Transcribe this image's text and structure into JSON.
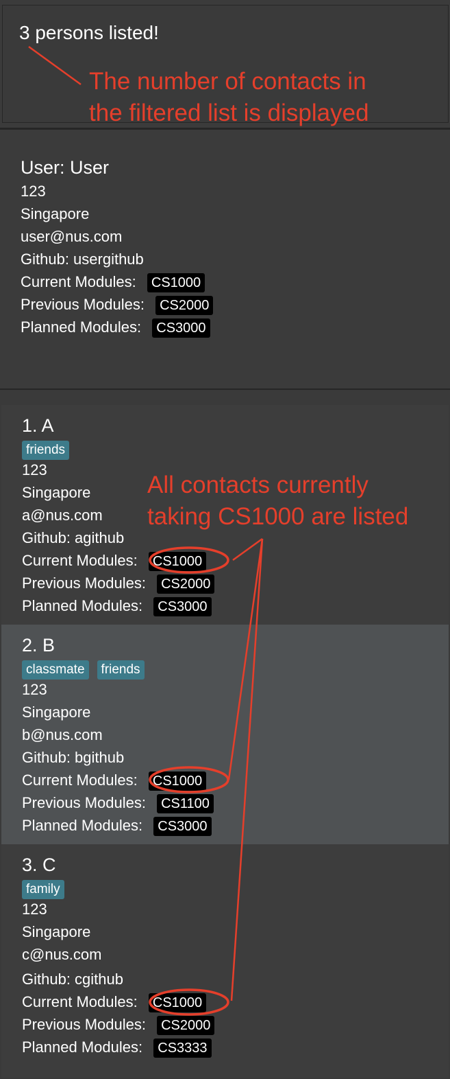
{
  "result": {
    "message": "3 persons listed!"
  },
  "user": {
    "name_line": "User:  User",
    "phone": "123",
    "address": "Singapore",
    "email": "user@nus.com",
    "github": "Github: usergithub",
    "current_label": "Current Modules:",
    "current_modules": [
      "CS1000"
    ],
    "previous_label": "Previous Modules:",
    "previous_modules": [
      "CS2000"
    ],
    "planned_label": "Planned Modules:",
    "planned_modules": [
      "CS3000"
    ]
  },
  "persons": [
    {
      "name_line": "1.  A",
      "tags": [
        "friends"
      ],
      "phone": "123",
      "address": "Singapore",
      "email": "a@nus.com",
      "github": "Github: agithub",
      "current_label": "Current Modules:",
      "current_modules": [
        "CS1000"
      ],
      "previous_label": "Previous Modules:",
      "previous_modules": [
        "CS2000"
      ],
      "planned_label": "Planned Modules:",
      "planned_modules": [
        "CS3000"
      ]
    },
    {
      "name_line": "2.  B",
      "tags": [
        "classmate",
        "friends"
      ],
      "phone": "123",
      "address": "Singapore",
      "email": "b@nus.com",
      "github": "Github: bgithub",
      "current_label": "Current Modules:",
      "current_modules": [
        "CS1000"
      ],
      "previous_label": "Previous Modules:",
      "previous_modules": [
        "CS1100"
      ],
      "planned_label": "Planned Modules:",
      "planned_modules": [
        "CS3000"
      ]
    },
    {
      "name_line": "3.  C",
      "tags": [
        "family"
      ],
      "phone": "123",
      "address": "Singapore",
      "email": "c@nus.com",
      "github": "Github: cgithub",
      "current_label": "Current Modules:",
      "current_modules": [
        "CS1000"
      ],
      "previous_label": "Previous Modules:",
      "previous_modules": [
        "CS2000"
      ],
      "planned_label": "Planned Modules:",
      "planned_modules": [
        "CS3333"
      ]
    }
  ],
  "annotations": {
    "count_note_line1": "The number of contacts in",
    "count_note_line2": "the filtered list is displayed",
    "filter_note_line1": "All contacts currently",
    "filter_note_line2": "taking CS1000 are listed"
  },
  "colors": {
    "background": "#3b3b3b",
    "tag": "#3d7b8a",
    "module_tag": "#000000",
    "annotation": "#e53f2b",
    "selected_card": "#4f5254"
  }
}
